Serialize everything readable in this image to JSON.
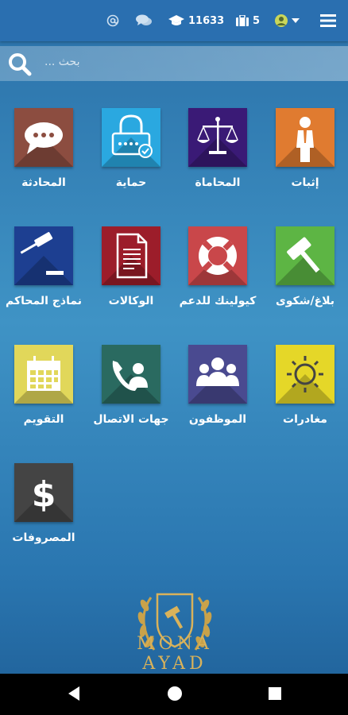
{
  "topbar": {
    "menu_icon": "hamburger-menu-icon",
    "user_icon": "user-avatar-icon",
    "briefcase_count": "5",
    "points_count": "11633",
    "chat_icon": "chat-icon",
    "at_icon": "at-icon"
  },
  "search": {
    "placeholder": "بحث ..."
  },
  "tiles": [
    {
      "label": "إثبات",
      "icon": "person-icon",
      "color": "#e07b30"
    },
    {
      "label": "المحاماة",
      "icon": "scales-icon",
      "color": "#3a1a76"
    },
    {
      "label": "حماية",
      "icon": "lock-icon",
      "color": "#2aa8e0"
    },
    {
      "label": "المحادثة",
      "icon": "chat-bubble-icon",
      "color": "#8c4d40"
    },
    {
      "label": "بلاغ/شكوى",
      "icon": "gavel-icon",
      "color": "#5db544"
    },
    {
      "label": "كيولينك للدعم",
      "icon": "lifebuoy-icon",
      "color": "#c9474a"
    },
    {
      "label": "الوكالات",
      "icon": "document-icon",
      "color": "#9c1d2a"
    },
    {
      "label": "نماذج المحاكم",
      "icon": "court-gavel-icon",
      "color": "#1d3f91"
    },
    {
      "label": "مغادرات",
      "icon": "sun-icon",
      "color": "#e5d728"
    },
    {
      "label": "الموظفون",
      "icon": "group-icon",
      "color": "#4a4a90"
    },
    {
      "label": "جهات الاتصال",
      "icon": "contact-phone-icon",
      "color": "#2a6a60"
    },
    {
      "label": "التقويم",
      "icon": "calendar-icon",
      "color": "#e1d75a"
    },
    {
      "label": "المصروفات",
      "icon": "dollar-icon",
      "color": "#444444"
    }
  ],
  "logo": {
    "text": "MONA AYAD"
  },
  "navbar": {
    "back": "back-icon",
    "home": "home-icon",
    "recents": "recents-icon"
  }
}
